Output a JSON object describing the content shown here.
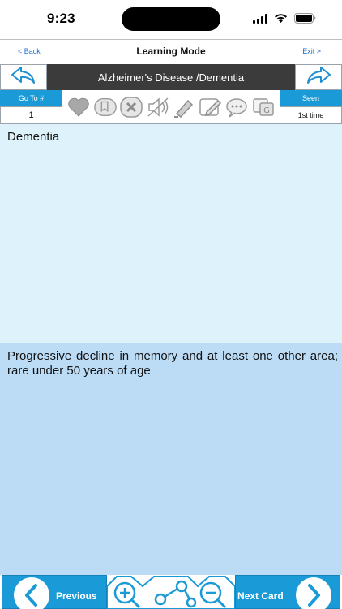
{
  "status_bar": {
    "time": "9:23",
    "icons": [
      "signal-icon",
      "wifi-icon",
      "battery-icon"
    ]
  },
  "nav": {
    "back_label": "< Back",
    "title": "Learning Mode",
    "exit_label": "Exit >"
  },
  "topic": {
    "title": "Alzheimer's Disease /Dementia",
    "prev_icon": "undo-arrow-icon",
    "next_icon": "redo-arrow-icon"
  },
  "toolbar": {
    "goto_label": "Go To #",
    "goto_value": "1",
    "seen_label": "Seen",
    "seen_value": "1st time",
    "icons": [
      "heart-icon",
      "bookmark-icon",
      "close-icon",
      "sound-off-icon",
      "highlighter-icon",
      "pencil-icon",
      "chat-icon",
      "translate-icon"
    ]
  },
  "card": {
    "question": "Dementia",
    "answer": "Progressive decline in memory and at least one other area; rare under 50 years of age"
  },
  "bottom": {
    "previous_label": "Previous",
    "next_label": "Next Card",
    "mid_icons": [
      "zoom-in-icon",
      "share-icon",
      "zoom-out-icon"
    ]
  },
  "colors": {
    "accent": "#1a9ad6",
    "topic_bar": "#3b3b3b",
    "question_bg": "#def2fc",
    "answer_bg": "#bcdcf6",
    "link": "#1c6fd0"
  }
}
